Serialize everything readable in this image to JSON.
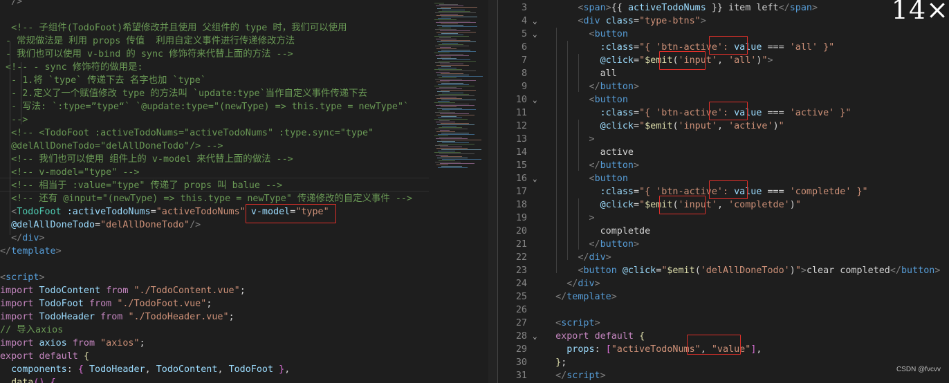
{
  "left": {
    "lines": [
      [
        [
          "tb",
          "  />"
        ]
      ],
      [],
      [
        [
          "c",
          "  <!-- 子组件(TodoFoot)希望修改并且使用 父组件的 type 时，我们可以使用"
        ]
      ],
      [
        [
          "c",
          " - 常规做法是 利用 props 传值  利用自定义事件进行传递修改方法"
        ]
      ],
      [
        [
          "c",
          " - 我们也可以使用 v-bind 的 sync 修饰符来代替上面的方法 -->"
        ]
      ],
      [
        [
          "c",
          " <!-- - sync 修饰符的做用是:"
        ]
      ],
      [
        [
          "c",
          "  - 1.将 `type` 传递下去 名字也加 `type`"
        ]
      ],
      [
        [
          "c",
          "  - 2.定义了一个赋值修改 type 的方法叫 `update:type`当作自定义事件传递下去"
        ]
      ],
      [
        [
          "c",
          "  - 写法: `:type=”type“` `@update:type=\"(newType) => this.type = newType\"`"
        ]
      ],
      [
        [
          "c",
          "  -->"
        ]
      ],
      [
        [
          "c",
          "  <!-- <TodoFoot :activeTodoNums=\"activeTodoNums\" :type.sync=\"type\""
        ]
      ],
      [
        [
          "c",
          "  @delAllDoneTodo=\"delAllDoneTodo\"/> -->"
        ]
      ],
      [
        [
          "c",
          "  <!-- 我们也可以使用 组件上的 v-model 来代替上面的做法 -->"
        ]
      ],
      [
        [
          "c",
          "  <!-- v-model=\"type\" -->"
        ]
      ],
      [
        [
          "c",
          "  <!-- 相当于 :value=\"type\" 传递了 props 叫 balue -->"
        ]
      ],
      [
        [
          "c",
          "  <!-- 还有 @input=\"(newType) => this.type = newType\" 传递修改的自定义事件 -->"
        ]
      ],
      [
        [
          "tb",
          "  <"
        ],
        [
          "tn",
          "TodoFoot"
        ],
        [
          "td",
          " "
        ],
        [
          "ta",
          ":activeTodoNums"
        ],
        [
          "td",
          "="
        ],
        [
          "ts",
          "\"activeTodoNums\""
        ],
        [
          "td",
          " "
        ],
        [
          "ta",
          "v-model"
        ],
        [
          "td",
          "="
        ],
        [
          "ts",
          "\"type\""
        ]
      ],
      [
        [
          "td",
          "  "
        ],
        [
          "ta",
          "@delAllDoneTodo"
        ],
        [
          "td",
          "="
        ],
        [
          "ts",
          "\"delAllDoneTodo\""
        ],
        [
          "tb",
          "/>"
        ]
      ],
      [
        [
          "tb",
          "  </"
        ],
        [
          "tg",
          "div"
        ],
        [
          "tb",
          ">"
        ]
      ],
      [
        [
          "tb",
          "</"
        ],
        [
          "tg",
          "template"
        ],
        [
          "tb",
          ">"
        ]
      ],
      [],
      [
        [
          "tb",
          "<"
        ],
        [
          "tg",
          "script"
        ],
        [
          "tb",
          ">"
        ]
      ],
      [
        [
          "tk",
          "import"
        ],
        [
          "td",
          " "
        ],
        [
          "ta",
          "TodoContent"
        ],
        [
          "td",
          " "
        ],
        [
          "tk",
          "from"
        ],
        [
          "td",
          " "
        ],
        [
          "ts",
          "\"./TodoContent.vue\""
        ],
        [
          "td",
          ";"
        ]
      ],
      [
        [
          "tk",
          "import"
        ],
        [
          "td",
          " "
        ],
        [
          "ta",
          "TodoFoot"
        ],
        [
          "td",
          " "
        ],
        [
          "tk",
          "from"
        ],
        [
          "td",
          " "
        ],
        [
          "ts",
          "\"./TodoFoot.vue\""
        ],
        [
          "td",
          ";"
        ]
      ],
      [
        [
          "tk",
          "import"
        ],
        [
          "td",
          " "
        ],
        [
          "ta",
          "TodoHeader"
        ],
        [
          "td",
          " "
        ],
        [
          "tk",
          "from"
        ],
        [
          "td",
          " "
        ],
        [
          "ts",
          "\"./TodoHeader.vue\""
        ],
        [
          "td",
          ";"
        ]
      ],
      [
        [
          "c",
          "// 导入axios"
        ]
      ],
      [
        [
          "tk",
          "import"
        ],
        [
          "td",
          " "
        ],
        [
          "ta",
          "axios"
        ],
        [
          "td",
          " "
        ],
        [
          "tk",
          "from"
        ],
        [
          "td",
          " "
        ],
        [
          "ts",
          "\"axios\""
        ],
        [
          "td",
          ";"
        ]
      ],
      [
        [
          "tk",
          "export"
        ],
        [
          "td",
          " "
        ],
        [
          "tk",
          "default"
        ],
        [
          "td",
          " "
        ],
        [
          "ty",
          "{"
        ]
      ],
      [
        [
          "td",
          "  "
        ],
        [
          "ta",
          "components"
        ],
        [
          "td",
          ": "
        ],
        [
          "tp",
          "{"
        ],
        [
          "td",
          " "
        ],
        [
          "ta",
          "TodoHeader"
        ],
        [
          "td",
          ", "
        ],
        [
          "ta",
          "TodoContent"
        ],
        [
          "td",
          ", "
        ],
        [
          "ta",
          "TodoFoot"
        ],
        [
          "td",
          " "
        ],
        [
          "tp",
          "}"
        ],
        [
          "td",
          ","
        ]
      ],
      [
        [
          "td",
          "  "
        ],
        [
          "ty",
          "data"
        ],
        [
          "tp",
          "()"
        ],
        [
          "td",
          " "
        ],
        [
          "tp",
          "{"
        ]
      ]
    ]
  },
  "right": {
    "line_numbers": [
      "3",
      "4",
      "5",
      "6",
      "7",
      "8",
      "9",
      "10",
      "11",
      "12",
      "13",
      "14",
      "15",
      "16",
      "17",
      "18",
      "19",
      "20",
      "21",
      "22",
      "23",
      "24",
      "25",
      "26",
      "27",
      "28",
      "29",
      "30",
      "31"
    ],
    "folds": [
      "",
      "⌄",
      "⌄",
      "",
      "",
      "",
      "",
      "⌄",
      "",
      "",
      "",
      "",
      "",
      "⌄",
      "",
      "",
      "",
      "",
      "",
      "",
      "",
      "",
      "",
      "",
      "",
      "⌄",
      "",
      "",
      ""
    ],
    "lines": [
      [
        [
          "td",
          "      "
        ],
        [
          "tb",
          "<"
        ],
        [
          "tg",
          "span"
        ],
        [
          "tb",
          ">"
        ],
        [
          "td",
          "{{ "
        ],
        [
          "ta",
          "activeTodoNums"
        ],
        [
          "td",
          " }} item left"
        ],
        [
          "tb",
          "</"
        ],
        [
          "tg",
          "span"
        ],
        [
          "tb",
          ">"
        ]
      ],
      [
        [
          "td",
          "      "
        ],
        [
          "tb",
          "<"
        ],
        [
          "tg",
          "div"
        ],
        [
          "td",
          " "
        ],
        [
          "ta",
          "class"
        ],
        [
          "td",
          "="
        ],
        [
          "ts",
          "\"type-btns\""
        ],
        [
          "tb",
          ">"
        ]
      ],
      [
        [
          "td",
          "        "
        ],
        [
          "tb",
          "<"
        ],
        [
          "tg",
          "button"
        ]
      ],
      [
        [
          "td",
          "          "
        ],
        [
          "ta",
          ":class"
        ],
        [
          "td",
          "="
        ],
        [
          "ts",
          "\"{ 'btn-active': "
        ],
        [
          "ta",
          "value"
        ],
        [
          "td",
          " === "
        ],
        [
          "ts",
          "'all'"
        ],
        [
          "ts",
          " }\""
        ]
      ],
      [
        [
          "td",
          "          "
        ],
        [
          "ta",
          "@click"
        ],
        [
          "td",
          "="
        ],
        [
          "ts",
          "\""
        ],
        [
          "ty",
          "$emit"
        ],
        [
          "td",
          "("
        ],
        [
          "ts",
          "'input'"
        ],
        [
          "td",
          ", "
        ],
        [
          "ts",
          "'all'"
        ],
        [
          "td",
          ")"
        ],
        [
          "ts",
          "\""
        ],
        [
          "tb",
          ">"
        ]
      ],
      [
        [
          "td",
          "          all"
        ]
      ],
      [
        [
          "td",
          "        "
        ],
        [
          "tb",
          "</"
        ],
        [
          "tg",
          "button"
        ],
        [
          "tb",
          ">"
        ]
      ],
      [
        [
          "td",
          "        "
        ],
        [
          "tb",
          "<"
        ],
        [
          "tg",
          "button"
        ]
      ],
      [
        [
          "td",
          "          "
        ],
        [
          "ta",
          ":class"
        ],
        [
          "td",
          "="
        ],
        [
          "ts",
          "\"{ 'btn-active': "
        ],
        [
          "ta",
          "value"
        ],
        [
          "td",
          " === "
        ],
        [
          "ts",
          "'active'"
        ],
        [
          "ts",
          " }\""
        ]
      ],
      [
        [
          "td",
          "          "
        ],
        [
          "ta",
          "@click"
        ],
        [
          "td",
          "="
        ],
        [
          "ts",
          "\""
        ],
        [
          "ty",
          "$emit"
        ],
        [
          "td",
          "("
        ],
        [
          "ts",
          "'input'"
        ],
        [
          "td",
          ", "
        ],
        [
          "ts",
          "'active'"
        ],
        [
          "td",
          ")"
        ],
        [
          "ts",
          "\""
        ]
      ],
      [
        [
          "td",
          "        "
        ],
        [
          "tb",
          ">"
        ]
      ],
      [
        [
          "td",
          "          active"
        ]
      ],
      [
        [
          "td",
          "        "
        ],
        [
          "tb",
          "</"
        ],
        [
          "tg",
          "button"
        ],
        [
          "tb",
          ">"
        ]
      ],
      [
        [
          "td",
          "        "
        ],
        [
          "tb",
          "<"
        ],
        [
          "tg",
          "button"
        ]
      ],
      [
        [
          "td",
          "          "
        ],
        [
          "ta",
          ":class"
        ],
        [
          "td",
          "="
        ],
        [
          "ts",
          "\"{ 'btn-active': "
        ],
        [
          "ta",
          "value"
        ],
        [
          "td",
          " === "
        ],
        [
          "ts",
          "'completde'"
        ],
        [
          "ts",
          " }\""
        ]
      ],
      [
        [
          "td",
          "          "
        ],
        [
          "ta",
          "@click"
        ],
        [
          "td",
          "="
        ],
        [
          "ts",
          "\""
        ],
        [
          "ty",
          "$emit"
        ],
        [
          "td",
          "("
        ],
        [
          "ts",
          "'input'"
        ],
        [
          "td",
          ", "
        ],
        [
          "ts",
          "'completde'"
        ],
        [
          "td",
          ")"
        ],
        [
          "ts",
          "\""
        ]
      ],
      [
        [
          "td",
          "        "
        ],
        [
          "tb",
          ">"
        ]
      ],
      [
        [
          "td",
          "          completde"
        ]
      ],
      [
        [
          "td",
          "        "
        ],
        [
          "tb",
          "</"
        ],
        [
          "tg",
          "button"
        ],
        [
          "tb",
          ">"
        ]
      ],
      [
        [
          "td",
          "      "
        ],
        [
          "tb",
          "</"
        ],
        [
          "tg",
          "div"
        ],
        [
          "tb",
          ">"
        ]
      ],
      [
        [
          "td",
          "      "
        ],
        [
          "tb",
          "<"
        ],
        [
          "tg",
          "button"
        ],
        [
          "td",
          " "
        ],
        [
          "ta",
          "@click"
        ],
        [
          "td",
          "="
        ],
        [
          "ts",
          "\""
        ],
        [
          "ty",
          "$emit"
        ],
        [
          "td",
          "("
        ],
        [
          "ts",
          "'delAllDoneTodo'"
        ],
        [
          "td",
          ")"
        ],
        [
          "ts",
          "\""
        ],
        [
          "tb",
          ">"
        ],
        [
          "td",
          "clear completed"
        ],
        [
          "tb",
          "</"
        ],
        [
          "tg",
          "button"
        ],
        [
          "tb",
          ">"
        ]
      ],
      [
        [
          "td",
          "    "
        ],
        [
          "tb",
          "</"
        ],
        [
          "tg",
          "div"
        ],
        [
          "tb",
          ">"
        ]
      ],
      [
        [
          "td",
          "  "
        ],
        [
          "tb",
          "</"
        ],
        [
          "tg",
          "template"
        ],
        [
          "tb",
          ">"
        ]
      ],
      [],
      [
        [
          "td",
          "  "
        ],
        [
          "tb",
          "<"
        ],
        [
          "tg",
          "script"
        ],
        [
          "tb",
          ">"
        ]
      ],
      [
        [
          "td",
          "  "
        ],
        [
          "tk",
          "export"
        ],
        [
          "td",
          " "
        ],
        [
          "tk",
          "default"
        ],
        [
          "td",
          " "
        ],
        [
          "ty",
          "{"
        ]
      ],
      [
        [
          "td",
          "    "
        ],
        [
          "ta",
          "props"
        ],
        [
          "td",
          ": "
        ],
        [
          "tp",
          "["
        ],
        [
          "ts",
          "\"activeTodoNums\""
        ],
        [
          "td",
          ", "
        ],
        [
          "ts",
          "\"value\""
        ],
        [
          "tp",
          "]"
        ],
        [
          "td",
          ","
        ]
      ],
      [
        [
          "td",
          "  "
        ],
        [
          "ty",
          "}"
        ],
        [
          "td",
          ";"
        ]
      ],
      [
        [
          "td",
          "  "
        ],
        [
          "tb",
          "</"
        ],
        [
          "tg",
          "script"
        ],
        [
          "tb",
          ">"
        ]
      ]
    ]
  },
  "overlay": {
    "corner_text": "14×",
    "watermark": "CSDN @fvcvv",
    "highlight_color": "#e0302a"
  }
}
